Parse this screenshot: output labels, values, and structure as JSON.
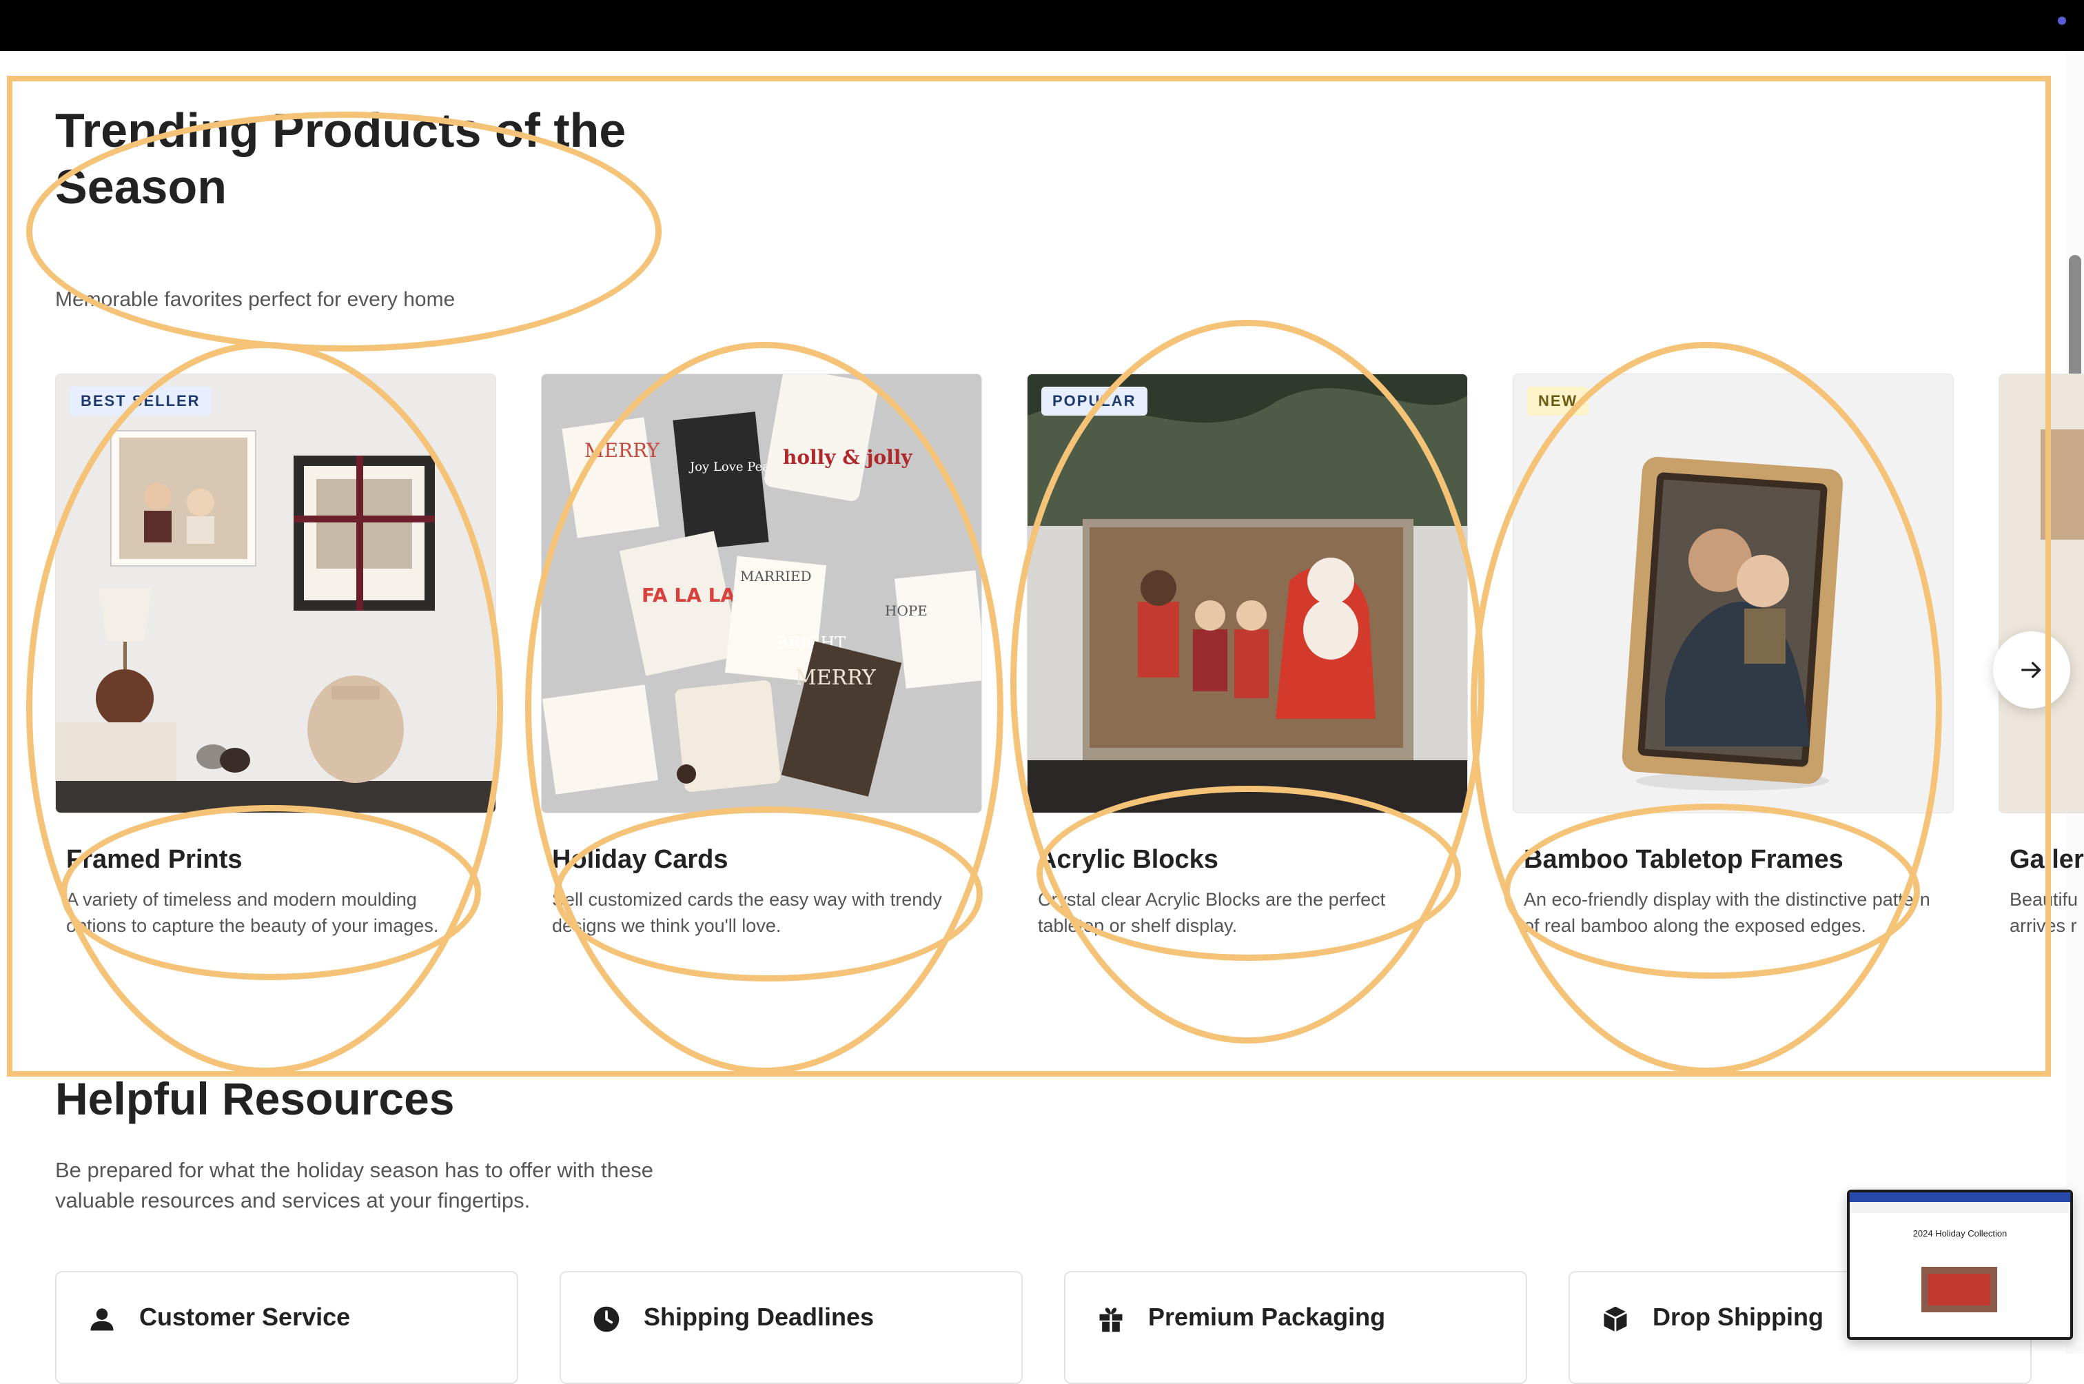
{
  "trending": {
    "title": "Trending Products of the Season",
    "subtitle": "Memorable favorites perfect for every home",
    "products": [
      {
        "badge": "BEST SELLER",
        "title": "Framed Prints",
        "description": "A variety of timeless and modern moulding options to capture the beauty of your images."
      },
      {
        "badge": "",
        "title": "Holiday Cards",
        "description": "Sell customized cards the easy way with trendy designs we think you'll love."
      },
      {
        "badge": "POPULAR",
        "title": "Acrylic Blocks",
        "description": "Crystal clear Acrylic Blocks are the perfect tabletop or shelf display."
      },
      {
        "badge": "NEW",
        "title": "Bamboo Tabletop Frames",
        "description": "An eco-friendly display with the distinctive pattern of real bamboo along the exposed edges."
      },
      {
        "badge": "",
        "title": "Galler",
        "description": "Beautifu arrives r"
      }
    ],
    "next_icon": "arrow-right-icon"
  },
  "holiday_card_text": [
    "MERRY",
    "Joy Love Peace & Merry",
    "holly & jolly",
    "FA LA LA",
    "MARRIED",
    "HOPE",
    "BRIGHT",
    "MERRY"
  ],
  "resources": {
    "title": "Helpful Resources",
    "subtitle": "Be prepared for what the holiday season has to offer with these valuable resources and services at your fingertips.",
    "items": [
      {
        "icon": "person-icon",
        "title": "Customer Service"
      },
      {
        "icon": "clock-icon",
        "title": "Shipping Deadlines"
      },
      {
        "icon": "gift-icon",
        "title": "Premium Packaging"
      },
      {
        "icon": "box-icon",
        "title": "Drop Shipping"
      }
    ]
  },
  "preview_thumbnail": {
    "title": "2024 Holiday Collection"
  },
  "colors": {
    "annotation": "#f5c377",
    "top_bar": "#000000",
    "badge_blue": "#e7efff",
    "badge_yellow": "#fdf3c8"
  }
}
